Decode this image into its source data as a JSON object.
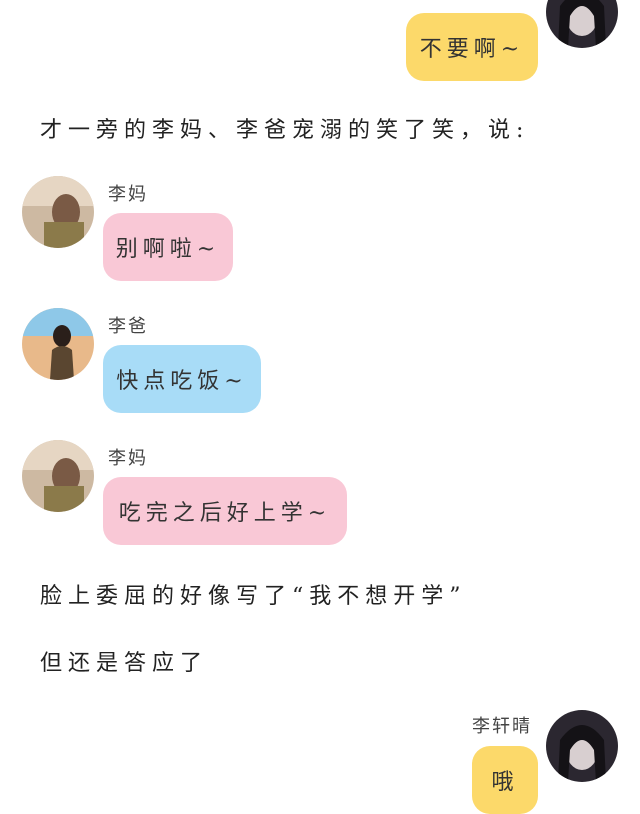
{
  "colors": {
    "yellow_bubble": "#fcd96a",
    "pink_bubble": "#f9c8d6",
    "blue_bubble": "#a8dcf7"
  },
  "messages": {
    "m1": {
      "text": "不要啊~"
    },
    "m2": {
      "sender": "李妈",
      "text": "别啊啦~"
    },
    "m3": {
      "sender": "李爸",
      "text": "快点吃饭~"
    },
    "m4": {
      "sender": "李妈",
      "text": "吃完之后好上学~"
    },
    "m5": {
      "sender": "李轩晴",
      "text": "哦"
    }
  },
  "narration": {
    "n1": "才一旁的李妈、李爸宠溺的笑了笑，说:",
    "n2": "脸上委屈的好像写了“我不想开学”",
    "n3": "但还是答应了"
  }
}
